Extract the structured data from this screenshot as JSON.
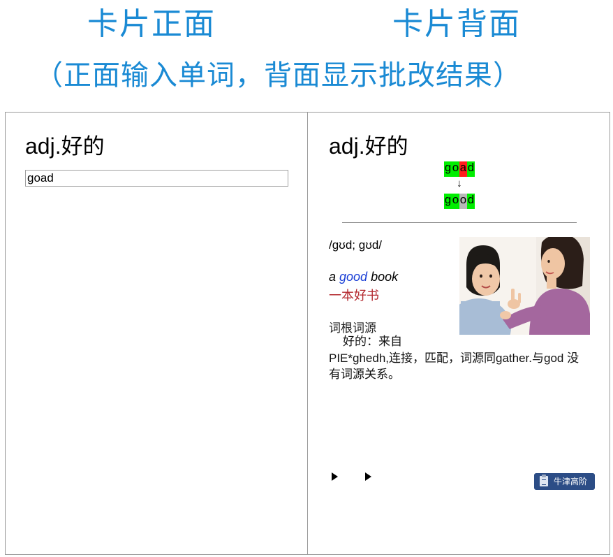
{
  "header": {
    "front_title": "卡片正面",
    "back_title": "卡片背面",
    "subtitle": "（正面输入单词，背面显示批改结果）"
  },
  "front": {
    "pos": "adj.",
    "meaning": "好的",
    "input_value": "goad"
  },
  "back": {
    "pos": "adj.",
    "meaning": "好的",
    "typed_letters": [
      "g",
      "o",
      "a",
      "d"
    ],
    "typed_status": [
      "ok",
      "ok",
      "bad",
      "ok"
    ],
    "arrow": "↓",
    "correct_letters": [
      "g",
      "o",
      "o",
      "d"
    ],
    "correct_status": [
      "ok",
      "ok",
      "fix",
      "ok"
    ],
    "phonetic": "/gʊd; gʊd/",
    "example_pre": "a ",
    "example_word": "good",
    "example_post": " book",
    "example_cn": "一本好书",
    "etymology_title": "词根词源",
    "etymology_line1": "好的：来自",
    "etymology_line2": "PIE*ghedh,连接，匹配，词源同gather.与god 没有词源关系。",
    "dict_button_label": "牛津高阶",
    "icons": {
      "play": "play-icon",
      "dict": "clipboard-icon"
    }
  },
  "colors": {
    "header_blue": "#1a8ad4",
    "correct_green": "#00ee00",
    "wrong_red": "#ff1d1d",
    "fixed_gray": "#b8b8b8",
    "example_blue": "#1a3fd6",
    "example_cn_red": "#b3282e",
    "dict_button": "#2c4d86"
  }
}
